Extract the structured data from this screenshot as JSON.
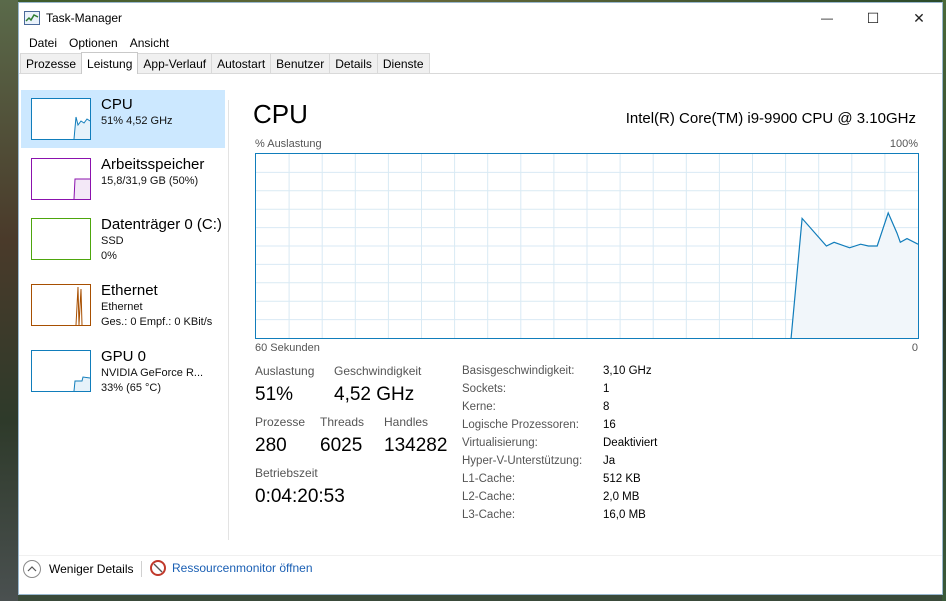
{
  "window": {
    "title": "Task-Manager",
    "minimize_glyph": "—",
    "maximize_glyph": "☐",
    "close_glyph": "✕"
  },
  "menu": [
    "Datei",
    "Optionen",
    "Ansicht"
  ],
  "tabs": [
    "Prozesse",
    "Leistung",
    "App-Verlauf",
    "Autostart",
    "Benutzer",
    "Details",
    "Dienste"
  ],
  "active_tab": "Leistung",
  "sidebar": {
    "items": [
      {
        "title": "CPU",
        "sub1": "51%  4,52 GHz",
        "sub2": "",
        "color": "#117dbb",
        "selected": true
      },
      {
        "title": "Arbeitsspeicher",
        "sub1": "15,8/31,9 GB (50%)",
        "sub2": "",
        "color": "#8b12ae",
        "selected": false
      },
      {
        "title": "Datenträger 0 (C:)",
        "sub1": "SSD",
        "sub2": "0%",
        "color": "#4da60c",
        "selected": false
      },
      {
        "title": "Ethernet",
        "sub1": "Ethernet",
        "sub2": "Ges.: 0  Empf.: 0 KBit/s",
        "color": "#a74f01",
        "selected": false
      },
      {
        "title": "GPU 0",
        "sub1": "NVIDIA GeForce R...",
        "sub2": "33%  (65 °C)",
        "color": "#117dbb",
        "selected": false
      }
    ]
  },
  "main": {
    "title": "CPU",
    "model": "Intel(R) Core(TM) i9-9900 CPU @ 3.10GHz",
    "graph_label_left": "% Auslastung",
    "graph_label_right": "100%",
    "graph_bottom_left": "60 Sekunden",
    "graph_bottom_right": "0",
    "stats": {
      "auslastung_label": "Auslastung",
      "auslastung": "51%",
      "geschwindigkeit_label": "Geschwindigkeit",
      "geschwindigkeit": "4,52 GHz",
      "prozesse_label": "Prozesse",
      "prozesse": "280",
      "threads_label": "Threads",
      "threads": "6025",
      "handles_label": "Handles",
      "handles": "134282",
      "betriebszeit_label": "Betriebszeit",
      "betriebszeit": "0:04:20:53"
    },
    "details": [
      {
        "label": "Basisgeschwindigkeit:",
        "value": "3,10 GHz"
      },
      {
        "label": "Sockets:",
        "value": "1"
      },
      {
        "label": "Kerne:",
        "value": "8"
      },
      {
        "label": "Logische Prozessoren:",
        "value": "16"
      },
      {
        "label": "Virtualisierung:",
        "value": "Deaktiviert"
      },
      {
        "label": "Hyper-V-Unterstützung:",
        "value": "Ja"
      },
      {
        "label": "L1-Cache:",
        "value": "512 KB"
      },
      {
        "label": "L2-Cache:",
        "value": "2,0 MB"
      },
      {
        "label": "L3-Cache:",
        "value": "16,0 MB"
      }
    ]
  },
  "graph_data": {
    "x_seconds_ago": [
      60,
      11.5,
      10.5,
      7.5,
      5.5,
      4,
      2.5,
      1.5,
      0
    ],
    "usage_percent": [
      0,
      0,
      65,
      50,
      49,
      50,
      49,
      48,
      51
    ],
    "note_start": "data begins at about 11.5 seconds ago",
    "series": [
      {
        "s": 11.5,
        "v": 0
      },
      {
        "s": 10.5,
        "v": 65
      },
      {
        "s": 8.3,
        "v": 50
      },
      {
        "s": 7.6,
        "v": 52
      },
      {
        "s": 6.2,
        "v": 49
      },
      {
        "s": 5.2,
        "v": 51
      },
      {
        "s": 4.5,
        "v": 50
      },
      {
        "s": 3.7,
        "v": 50
      },
      {
        "s": 2.7,
        "v": 68
      },
      {
        "s": 1.9,
        "v": 57
      },
      {
        "s": 1.6,
        "v": 52
      },
      {
        "s": 1.0,
        "v": 54
      },
      {
        "s": 0,
        "v": 51
      }
    ]
  },
  "footer": {
    "less_details": "Weniger Details",
    "resource_monitor": "Ressourcenmonitor öffnen"
  },
  "colors": {
    "accent": "#117dbb",
    "selected_bg": "#cce8ff",
    "link": "#1a5fb4"
  }
}
